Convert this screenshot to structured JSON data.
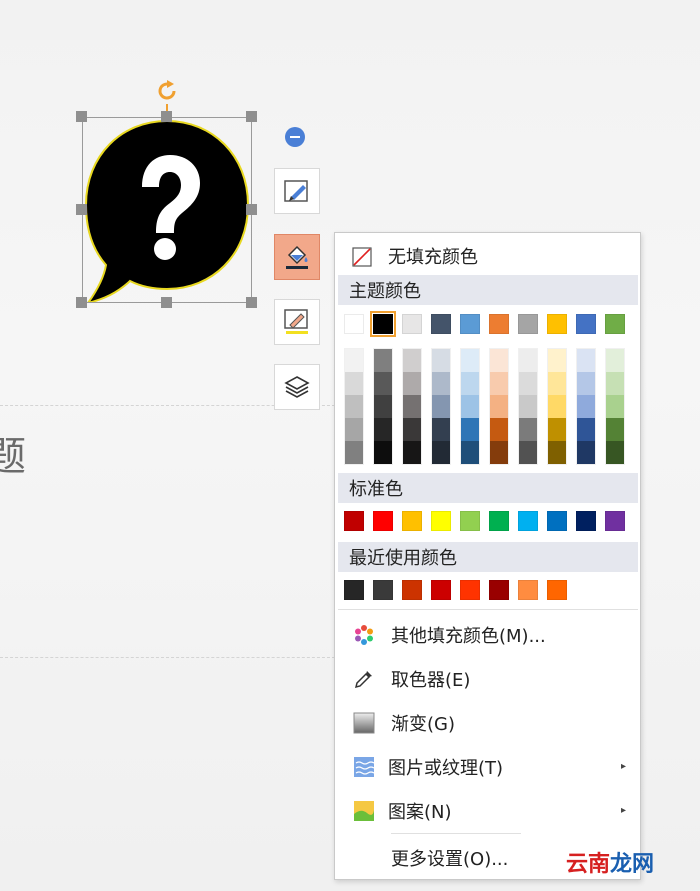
{
  "slide": {
    "fragment_char": "题"
  },
  "menu": {
    "no_fill": "无填充颜色",
    "theme_title": "主题颜色",
    "theme_colors": [
      "#ffffff",
      "#000000",
      "#e7e6e6",
      "#44546a",
      "#5b9bd5",
      "#ed7d31",
      "#a5a5a5",
      "#ffc000",
      "#4472c4",
      "#70ad47"
    ],
    "theme_shades": [
      [
        "#f2f2f2",
        "#d9d9d9",
        "#bfbfbf",
        "#a6a6a6",
        "#808080"
      ],
      [
        "#7f7f7f",
        "#595959",
        "#404040",
        "#262626",
        "#0d0d0d"
      ],
      [
        "#d0cece",
        "#aeaaaa",
        "#757171",
        "#3a3838",
        "#171616"
      ],
      [
        "#d6dce4",
        "#adb9ca",
        "#8496b0",
        "#333f50",
        "#222a35"
      ],
      [
        "#ddebf7",
        "#bdd7ee",
        "#9dc3e6",
        "#2e75b6",
        "#1f4e79"
      ],
      [
        "#fbe5d6",
        "#f8cbad",
        "#f4b183",
        "#c55a11",
        "#843c0c"
      ],
      [
        "#ededed",
        "#dbdbdb",
        "#c9c9c9",
        "#7b7b7b",
        "#525252"
      ],
      [
        "#fff2cc",
        "#ffe699",
        "#ffd966",
        "#bf9000",
        "#7f6000"
      ],
      [
        "#dae3f3",
        "#b4c7e7",
        "#8faadc",
        "#2f5597",
        "#1f3864"
      ],
      [
        "#e2efda",
        "#c6e0b4",
        "#a9d18e",
        "#548235",
        "#375623"
      ]
    ],
    "standard_title": "标准色",
    "standard_colors": [
      "#c00000",
      "#ff0000",
      "#ffc000",
      "#ffff00",
      "#92d050",
      "#00b050",
      "#00b0f0",
      "#0070c0",
      "#002060",
      "#7030a0"
    ],
    "recent_title": "最近使用颜色",
    "recent_colors": [
      "#262626",
      "#3a3a3a",
      "#cc3300",
      "#cc0000",
      "#ff3300",
      "#990000",
      "#ff8c40",
      "#ff6600"
    ],
    "more_fill": "其他填充颜色(M)...",
    "eyedropper": "取色器(E)",
    "gradient": "渐变(G)",
    "picture_texture": "图片或纹理(T)",
    "pattern": "图案(N)",
    "more_settings": "更多设置(O)..."
  },
  "watermark": {
    "part1": "云南",
    "part2": "龙网"
  }
}
